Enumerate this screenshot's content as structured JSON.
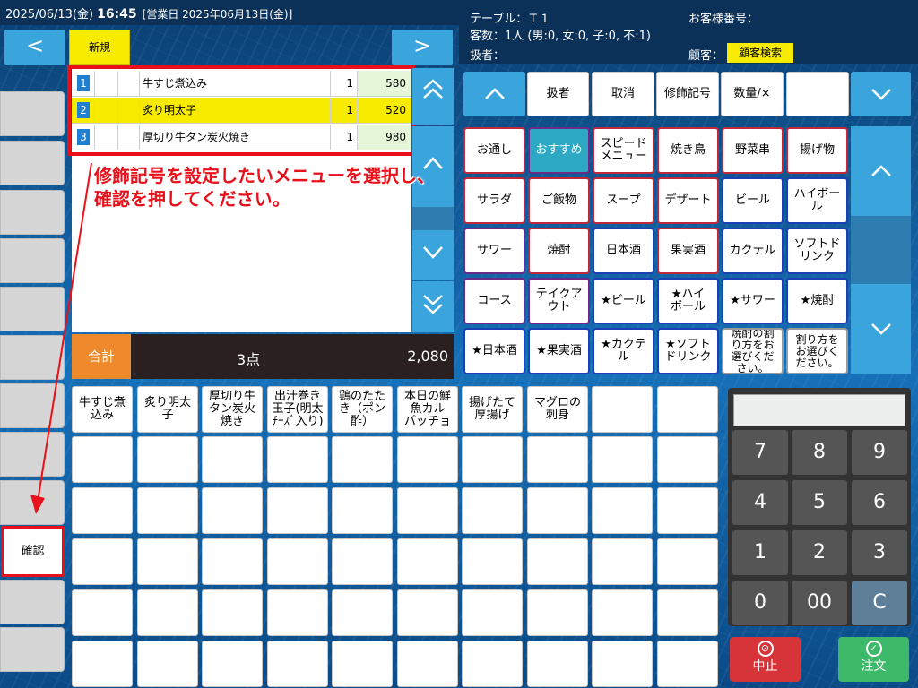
{
  "header": {
    "date": "2025/06/13(金)",
    "time": "16:45",
    "business_day": "[営業日 2025年06月13日(金)]"
  },
  "table_info": {
    "table": "テーブル：Ｔ１",
    "guests": "客数：1人 (男:0, 女:0, 子:0, 不:1)",
    "staff": "扱者：",
    "customer_no": "お客様番号：",
    "customer": "顧客：",
    "customer_search": "顧客検索"
  },
  "nav": {
    "prev": "<",
    "next": ">",
    "new_tab": "新規"
  },
  "order_items": [
    {
      "no": "1",
      "name": "牛すじ煮込み",
      "qty": "1",
      "price": "580",
      "selected": false
    },
    {
      "no": "2",
      "name": "炙り明太子",
      "qty": "1",
      "price": "520",
      "selected": true
    },
    {
      "no": "3",
      "name": "厚切り牛タン炭火焼き",
      "qty": "1",
      "price": "980",
      "selected": false
    }
  ],
  "total": {
    "label": "合計",
    "count": "3点",
    "amount": "2,080"
  },
  "instruction": [
    "修飾記号を設定したいメニューを選択し、",
    "確認を押してください。"
  ],
  "side": {
    "confirm": "確認"
  },
  "toolbar": {
    "up": "^",
    "staff": "扱者",
    "cancel": "取消",
    "modifier": "修飾記号",
    "qty": "数量/×",
    "blank": "",
    "down": "v"
  },
  "categories": [
    [
      "お通し",
      "おすすめ",
      "スピード\nメニュー",
      "焼き鳥",
      "野菜串",
      "揚げ物"
    ],
    [
      "サラダ",
      "ご飯物",
      "スープ",
      "デザート",
      "ビール",
      "ハイボー\nル"
    ],
    [
      "サワー",
      "焼酎",
      "日本酒",
      "果実酒",
      "カクテル",
      "ソフトド\nリンク"
    ],
    [
      "コース",
      "テイクア\nウト",
      "★ビール",
      "★ハイ\nボール",
      "★サワー",
      "★焼酎"
    ],
    [
      "★日本酒",
      "★果実酒",
      "★カクテ\nル",
      "★ソフト\nドリンク",
      "焼酎の割\nり方をお\n選びくだ\nさい。",
      "割り方を\nお選びく\nださい。"
    ]
  ],
  "favorites": [
    [
      "牛すじ煮\n込み",
      "炙り明太\n子",
      "厚切り牛\nタン炭火\n焼き",
      "出汁巻き\n玉子(明太\nﾁｰｽﾞ入り)",
      "鶏のたた\nき（ポン\n酢）",
      "本日の鮮\n魚カル\nパッチョ",
      "揚げたて\n厚揚げ",
      "マグロの\n刺身",
      "",
      ""
    ]
  ],
  "numpad": {
    "keys": [
      "7",
      "8",
      "9",
      "4",
      "5",
      "6",
      "1",
      "2",
      "3",
      "0",
      "00",
      "C"
    ],
    "display": ""
  },
  "actions": {
    "stop": "中止",
    "order": "注文"
  }
}
